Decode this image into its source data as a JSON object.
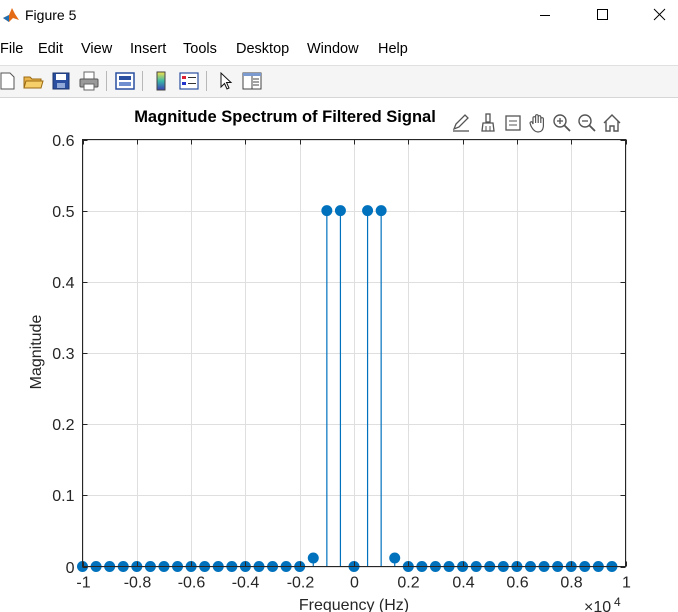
{
  "window": {
    "title": "Figure 5"
  },
  "menu": [
    "File",
    "Edit",
    "View",
    "Insert",
    "Tools",
    "Desktop",
    "Window",
    "Help"
  ],
  "toolbar": {
    "items": [
      "new-figure-icon",
      "open-file-icon",
      "save-icon",
      "print-icon",
      "print-preview-icon",
      "colorbar-icon",
      "legend-icon",
      "pointer-icon",
      "property-inspector-icon"
    ]
  },
  "axes_toolbar": {
    "items": [
      "edit-plot-icon",
      "brush-icon",
      "data-tips-icon",
      "pan-icon",
      "zoom-in-icon",
      "zoom-out-icon",
      "home-icon"
    ]
  },
  "chart_data": {
    "type": "stem",
    "title": "Magnitude Spectrum of Filtered Signal",
    "xlabel": "Frequency (Hz)",
    "ylabel": "Magnitude",
    "x_multiplier_label": "×10",
    "x_multiplier_exponent": "4",
    "xlim": [
      -1,
      1
    ],
    "ylim": [
      0,
      0.6
    ],
    "xticks": [
      -1,
      -0.8,
      -0.6,
      -0.4,
      -0.2,
      0,
      0.2,
      0.4,
      0.6,
      0.8,
      1
    ],
    "xtick_labels": [
      "-1",
      "-0.8",
      "-0.6",
      "-0.4",
      "-0.2",
      "0",
      "0.2",
      "0.4",
      "0.6",
      "0.8",
      "1"
    ],
    "yticks": [
      0,
      0.1,
      0.2,
      0.3,
      0.4,
      0.5,
      0.6
    ],
    "ytick_labels": [
      "0",
      "0.1",
      "0.2",
      "0.3",
      "0.4",
      "0.5",
      "0.6"
    ],
    "grid": true,
    "color": "#0072BD",
    "x": [
      -1,
      -0.95,
      -0.9,
      -0.85,
      -0.8,
      -0.75,
      -0.7,
      -0.65,
      -0.6,
      -0.55,
      -0.5,
      -0.45,
      -0.4,
      -0.35,
      -0.3,
      -0.25,
      -0.2,
      -0.15,
      -0.1,
      -0.05,
      0,
      0.05,
      0.1,
      0.15,
      0.2,
      0.25,
      0.3,
      0.35,
      0.4,
      0.45,
      0.5,
      0.55,
      0.6,
      0.65,
      0.7,
      0.75,
      0.8,
      0.85,
      0.9,
      0.95
    ],
    "y": [
      0,
      0,
      0,
      0,
      0,
      0,
      0,
      0,
      0,
      0,
      0,
      0,
      0,
      0,
      0,
      0,
      0,
      0.012,
      0.5,
      0.5,
      0,
      0.5,
      0.5,
      0.012,
      0,
      0,
      0,
      0,
      0,
      0,
      0,
      0,
      0,
      0,
      0,
      0,
      0,
      0,
      0,
      0
    ]
  }
}
